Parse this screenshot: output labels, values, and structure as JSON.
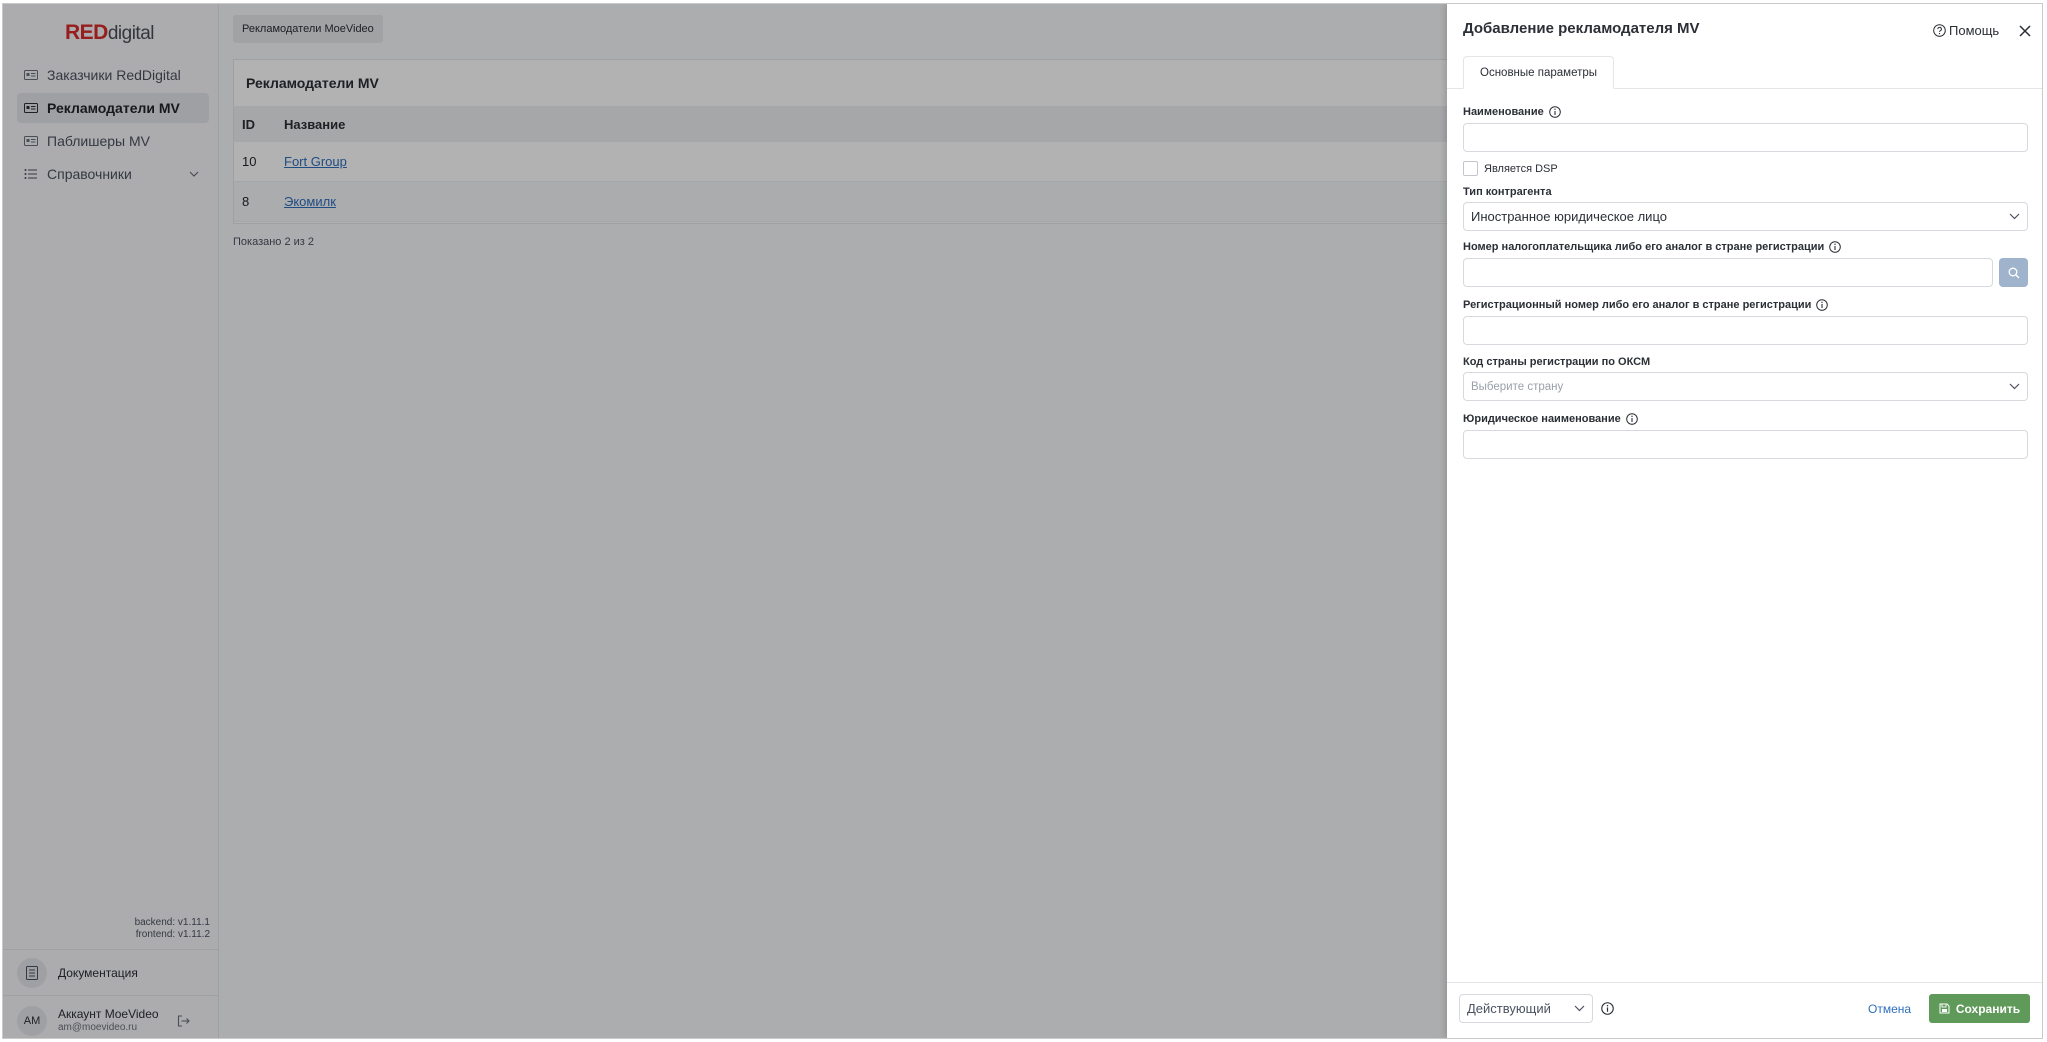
{
  "logo": {
    "red": "RED",
    "digital": "digital"
  },
  "sidebar": {
    "items": [
      {
        "label": "Заказчики RedDigital",
        "icon": "id-card-icon"
      },
      {
        "label": "Рекламодатели MV",
        "icon": "id-card-icon",
        "active": true
      },
      {
        "label": "Паблишеры MV",
        "icon": "id-card-icon"
      },
      {
        "label": "Справочники",
        "icon": "list-icon"
      }
    ],
    "versions": {
      "backend": "backend: v1.11.1",
      "frontend": "frontend: v1.11.2"
    },
    "docs_label": "Документация",
    "account": {
      "initials": "AM",
      "name": "Аккаунт MoeVideo",
      "email": "am@moevideo.ru"
    }
  },
  "main": {
    "breadcrumb": "Рекламодатели MoeVideo",
    "card_title": "Рекламодатели MV",
    "columns": [
      "ID",
      "Название"
    ],
    "rows": [
      {
        "id": "10",
        "name": "Fort Group"
      },
      {
        "id": "8",
        "name": "Экомилк"
      }
    ],
    "shown": "Показано 2 из 2"
  },
  "drawer": {
    "title": "Добавление рекламодателя MV",
    "help": "Помощь",
    "tab": "Основные параметры",
    "fields": {
      "name_label": "Наименование",
      "name_value": "",
      "dsp_label": "Является DSP",
      "dsp_checked": false,
      "type_label": "Тип контрагента",
      "type_value": "Иностранное юридическое лицо",
      "inn_label": "Номер налогоплательщика либо его аналог в стране регистрации",
      "inn_value": "",
      "reg_label": "Регистрационный номер либо его аналог в стране регистрации",
      "reg_value": "",
      "country_label": "Код страны регистрации по ОКСМ",
      "country_placeholder": "Выберите страну",
      "legal_label": "Юридическое наименование",
      "legal_value": ""
    },
    "footer": {
      "status": "Действующий",
      "cancel": "Отмена",
      "save": "Сохранить"
    }
  },
  "colors": {
    "accent": "#2e6fbd",
    "brand_red": "#d92b2b",
    "save_green": "#5f9a5a",
    "search_btn": "#9fb3cc"
  }
}
